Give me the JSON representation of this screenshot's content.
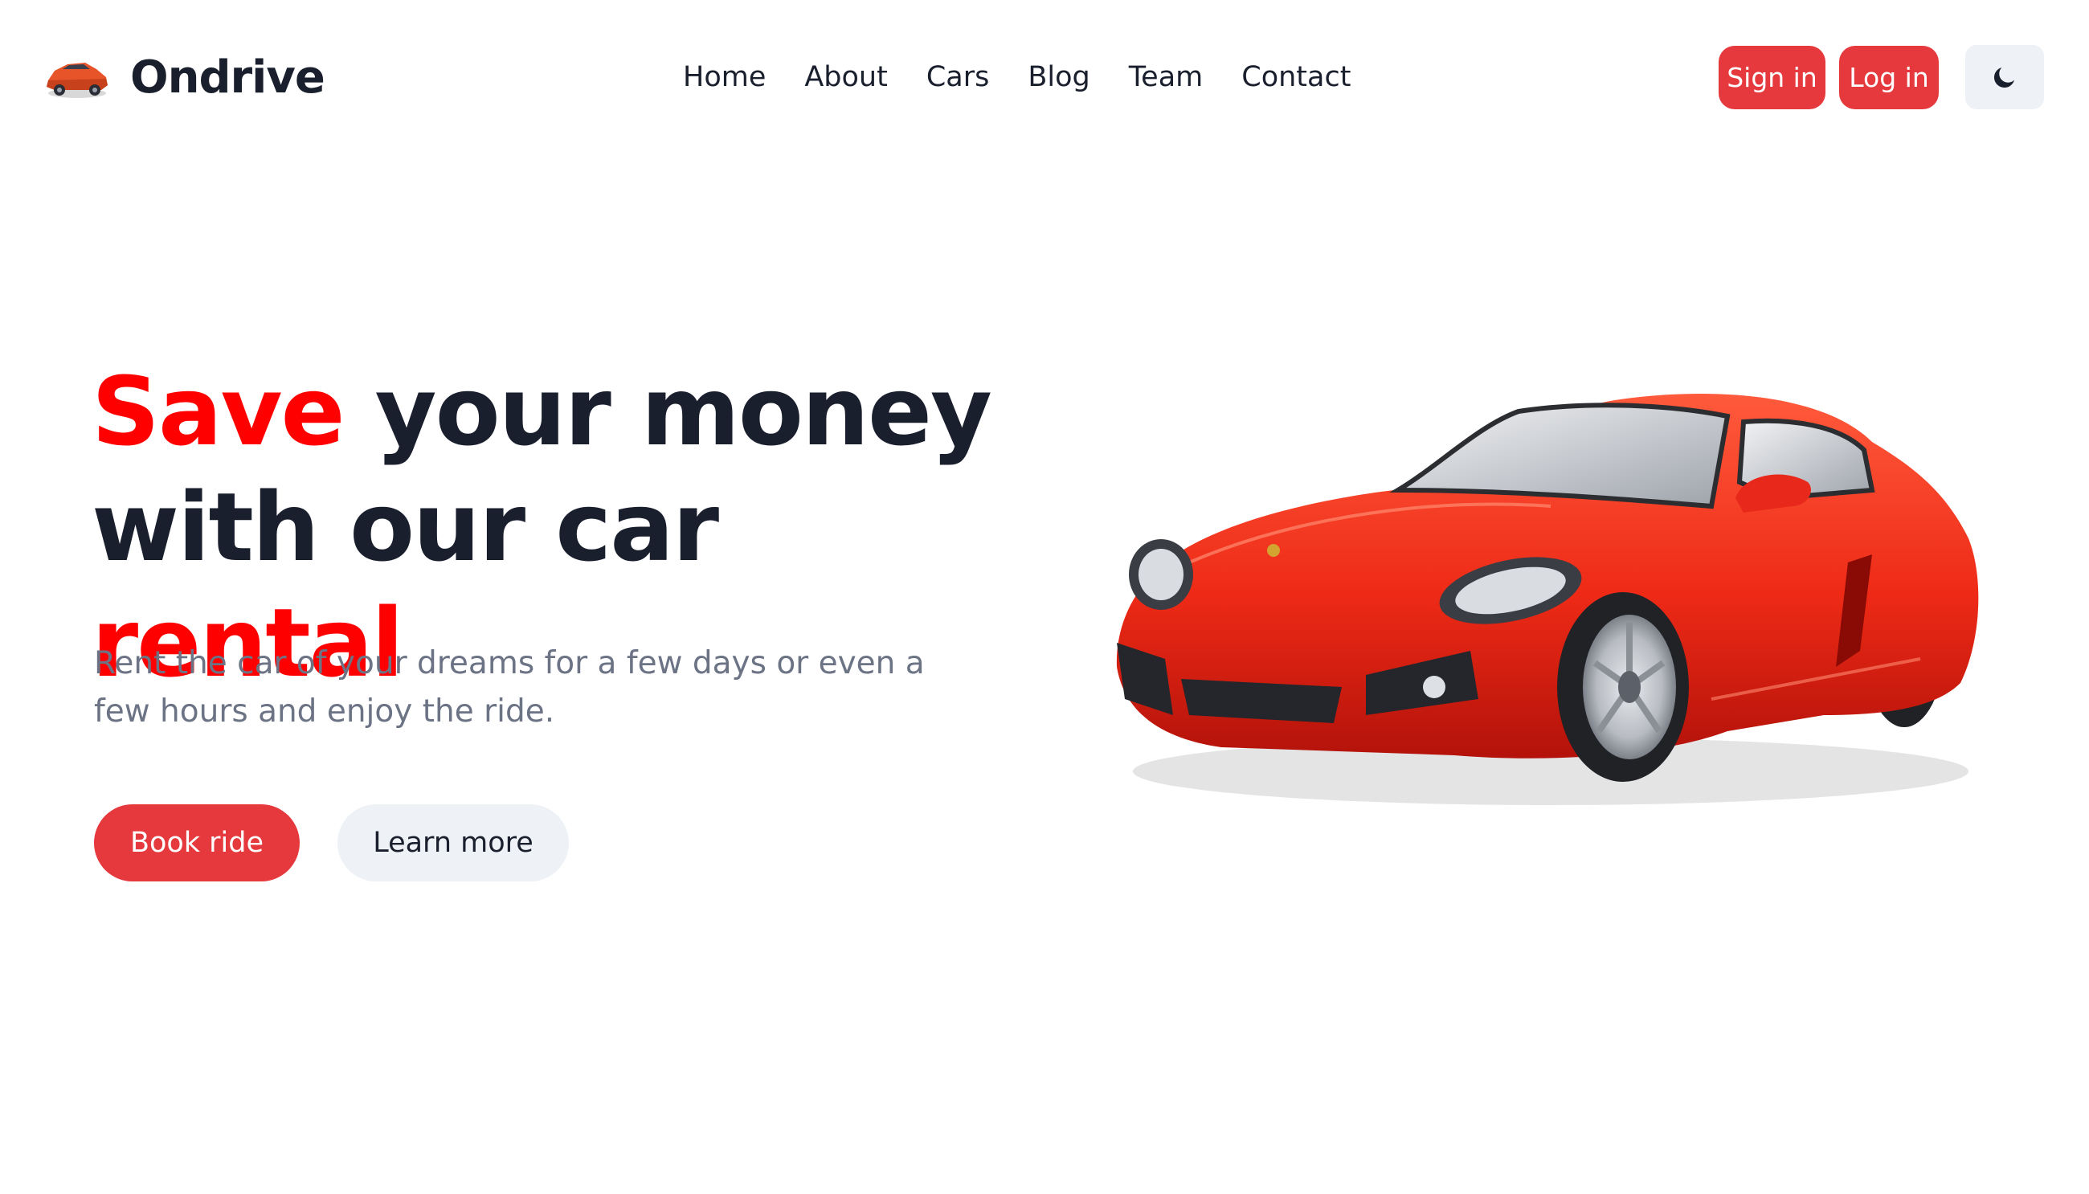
{
  "brand": {
    "name": "Ondrive",
    "logo_icon": "car-logo-icon"
  },
  "nav": {
    "items": [
      "Home",
      "About",
      "Cars",
      "Blog",
      "Team",
      "Contact"
    ]
  },
  "auth": {
    "signin_label": "Sign in",
    "login_label": "Log in"
  },
  "theme_toggle": {
    "icon": "moon-icon"
  },
  "hero": {
    "title_accent_1": "Save",
    "title_line_1_rest": " your money",
    "title_line_2_start": "with our car ",
    "title_accent_2": "rental",
    "subtitle": "Rent the car of your dreams for a few days or even a few hours and enjoy the ride.",
    "book_label": "Book ride",
    "learn_label": "Learn more",
    "image": "red-sports-car-image"
  },
  "colors": {
    "accent_red": "#ff0000",
    "button_red": "#e5393d",
    "text_dark": "#1a1f2e",
    "text_muted": "#6b7385",
    "button_light": "#eef1f5"
  }
}
